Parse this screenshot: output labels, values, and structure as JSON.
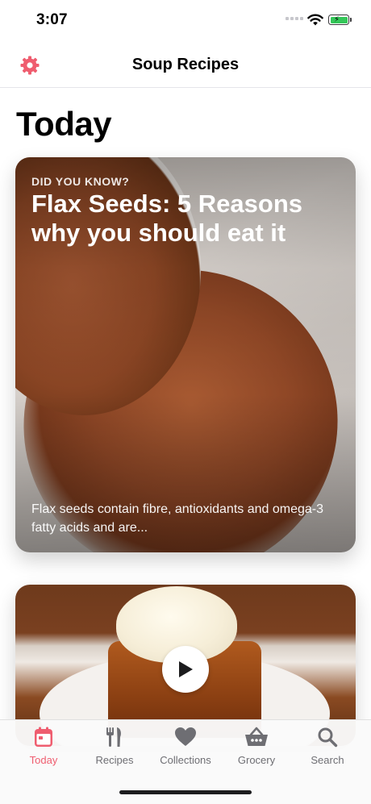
{
  "status_bar": {
    "time": "3:07"
  },
  "nav": {
    "title": "Soup Recipes",
    "settings_icon": "gear-icon"
  },
  "page": {
    "large_title": "Today"
  },
  "feature_card": {
    "eyebrow": "DID YOU KNOW?",
    "headline": "Flax Seeds: 5 Reasons why you should eat it",
    "description": "Flax seeds contain fibre, antioxidants and omega-3 fatty acids and are..."
  },
  "video_card": {
    "play_icon": "play-icon"
  },
  "tabs": [
    {
      "label": "Today",
      "icon": "calendar-icon",
      "active": true
    },
    {
      "label": "Recipes",
      "icon": "fork-knife-icon",
      "active": false
    },
    {
      "label": "Collections",
      "icon": "heart-icon",
      "active": false
    },
    {
      "label": "Grocery",
      "icon": "basket-icon",
      "active": false
    },
    {
      "label": "Search",
      "icon": "search-icon",
      "active": false
    }
  ],
  "colors": {
    "accent": "#ef5d6f",
    "tab_inactive": "#6e6e73",
    "battery": "#34c759"
  }
}
